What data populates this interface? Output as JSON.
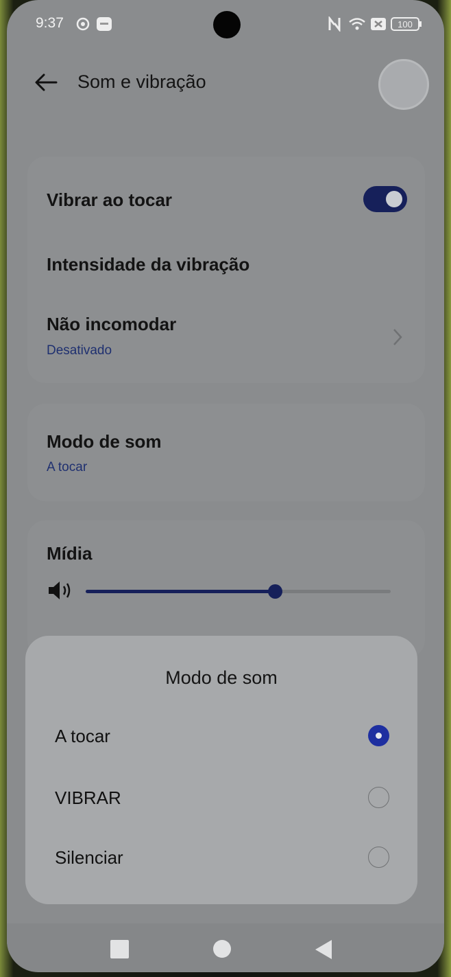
{
  "status_bar": {
    "time": "9:37",
    "battery": "100"
  },
  "header": {
    "title": "Som e vibração"
  },
  "settings": {
    "vibrate_on_touch": {
      "label": "Vibrar ao tocar",
      "enabled": true
    },
    "vibration_intensity": {
      "label": "Intensidade da vibração"
    },
    "do_not_disturb": {
      "label": "Não incomodar",
      "value": "Desativado"
    },
    "sound_mode": {
      "label": "Modo de som",
      "value": "A tocar"
    },
    "media": {
      "label": "Mídia",
      "volume_fraction": 0.62
    }
  },
  "dialog": {
    "title": "Modo de som",
    "options": [
      {
        "label": "A tocar",
        "selected": true
      },
      {
        "label": "VIBRAR",
        "selected": false
      },
      {
        "label": "Silenciar",
        "selected": false
      }
    ]
  },
  "colors": {
    "accent": "#16205a",
    "radio_selected": "#1e2fa0",
    "subtitle": "#1f3070"
  },
  "icons": [
    "back-arrow-icon",
    "chevron-right-icon",
    "speaker-icon",
    "wifi-icon",
    "nfc-icon",
    "battery-icon"
  ]
}
